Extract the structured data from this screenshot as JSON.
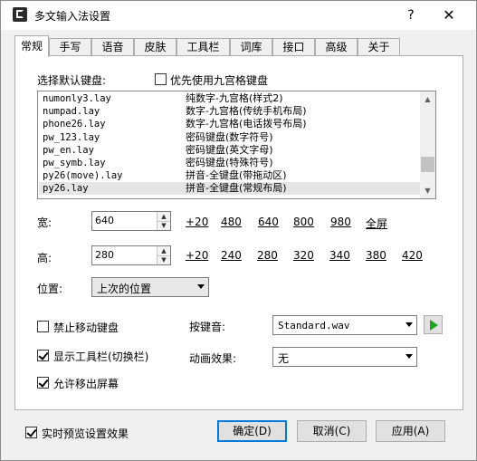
{
  "window": {
    "title": "多文输入法设置",
    "help": "?",
    "close": "✕"
  },
  "tabs": [
    "常规",
    "手写",
    "语音",
    "皮肤",
    "工具栏",
    "词库",
    "接口",
    "高级",
    "关于"
  ],
  "keyboard": {
    "label": "选择默认键盘:",
    "nine_grid_label": "优先使用九宫格键盘",
    "nine_grid_checked": false,
    "rows": [
      {
        "file": "numonly3.lay",
        "desc": "纯数字-九宫格(样式2)"
      },
      {
        "file": "numpad.lay",
        "desc": "数字-九宫格(传统手机布局)"
      },
      {
        "file": "phone26.lay",
        "desc": "数字-九宫格(电话拨号布局)"
      },
      {
        "file": "pw_123.lay",
        "desc": "密码键盘(数字符号)"
      },
      {
        "file": "pw_en.lay",
        "desc": "密码键盘(英文字母)"
      },
      {
        "file": "pw_symb.lay",
        "desc": "密码键盘(特殊符号)"
      },
      {
        "file": "py26(move).lay",
        "desc": "拼音-全键盘(带拖动区)"
      },
      {
        "file": "py26.lay",
        "desc": "拼音-全键盘(常规布局)"
      }
    ],
    "selected_index": 7
  },
  "width": {
    "label": "宽:",
    "value": "640",
    "presets": [
      "+20",
      "480",
      "640",
      "800",
      "980",
      "全屏"
    ]
  },
  "height": {
    "label": "高:",
    "value": "280",
    "presets": [
      "+20",
      "240",
      "280",
      "320",
      "340",
      "380",
      "420"
    ]
  },
  "position": {
    "label": "位置:",
    "value": "上次的位置"
  },
  "options": {
    "disable_move": {
      "label": "禁止移动键盘",
      "checked": false
    },
    "show_toolbar": {
      "label": "显示工具栏(切换栏)",
      "checked": true
    },
    "allow_offscreen": {
      "label": "允许移出屏幕",
      "checked": true
    }
  },
  "key_sound": {
    "label": "按键音:",
    "value": "Standard.wav"
  },
  "animation": {
    "label": "动画效果:",
    "value": "无"
  },
  "footer": {
    "preview": {
      "label": "实时预览设置效果",
      "checked": true
    },
    "ok": "确定(D)",
    "cancel": "取消(C)",
    "apply": "应用(A)"
  }
}
